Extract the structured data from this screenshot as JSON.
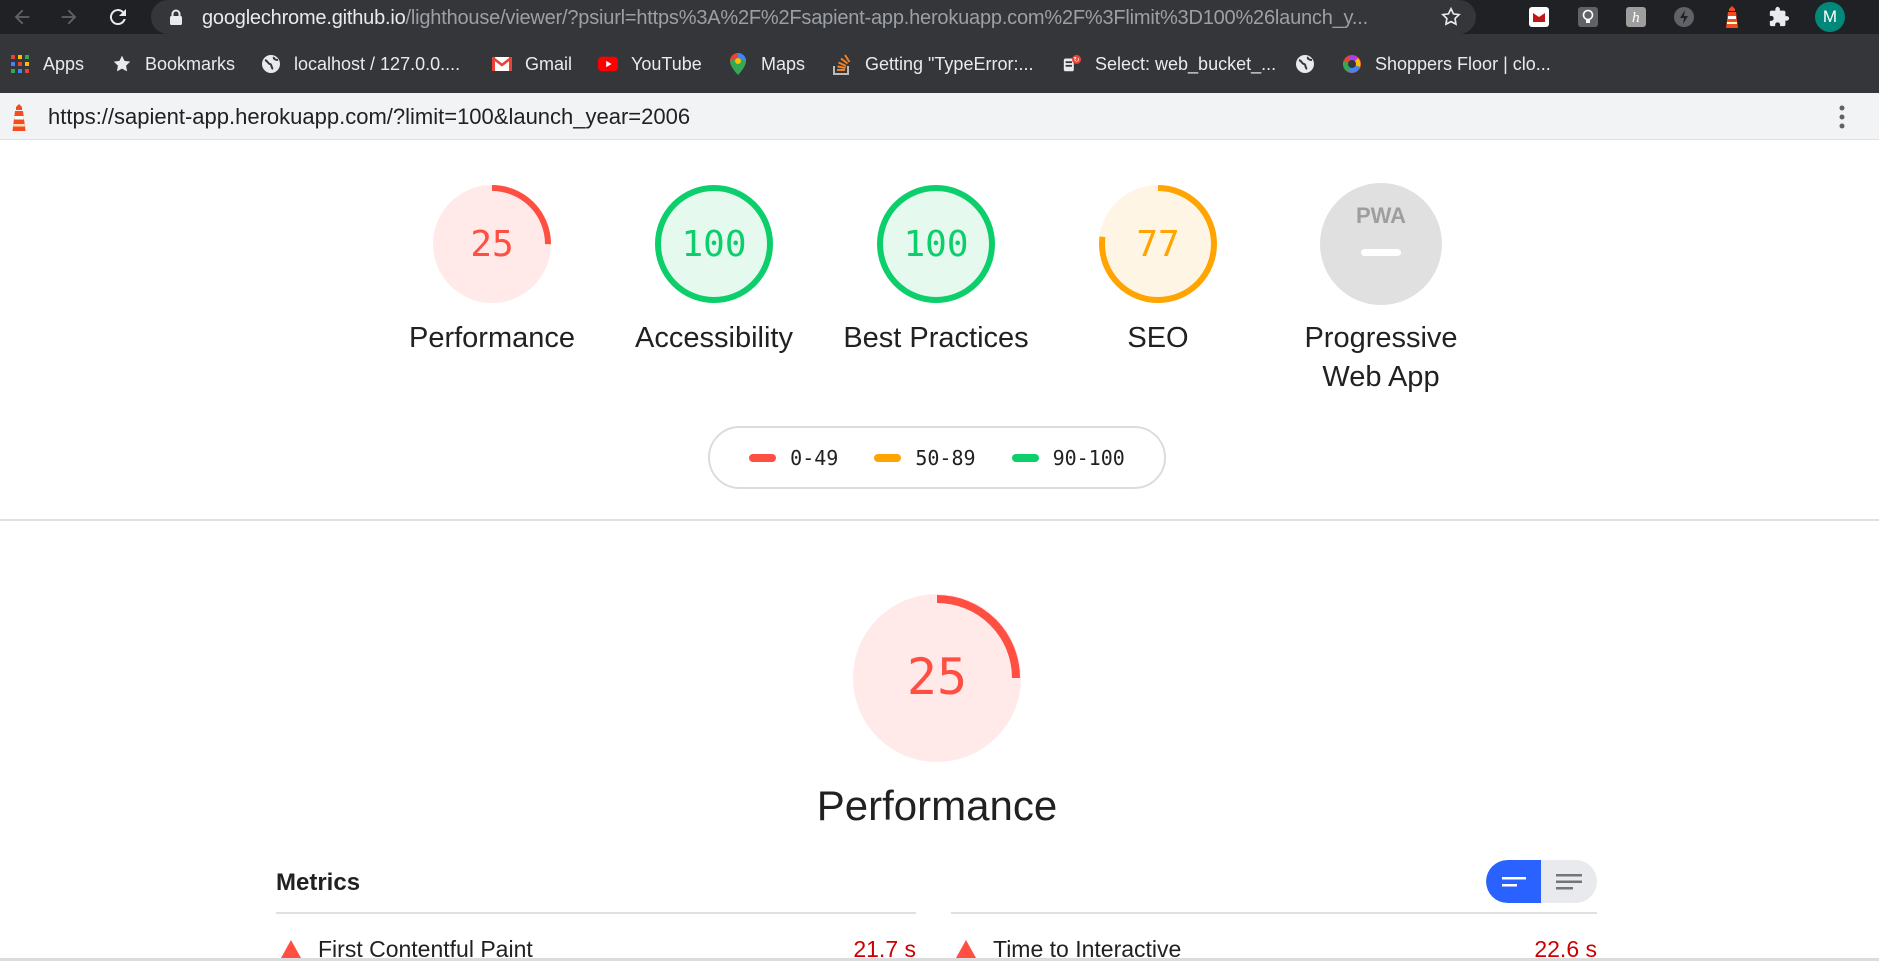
{
  "browser": {
    "url_host": "googlechrome.github.io",
    "url_path": "/lighthouse/viewer/?psiurl=https%3A%2F%2Fsapient-app.herokuapp.com%2F%3Flimit%3D100%26launch_y...",
    "profile_initial": "M",
    "extensions": [
      "mcafee-icon",
      "bulb-icon",
      "heroku-icon",
      "lightning-icon",
      "lighthouse-icon",
      "puzzle-icon"
    ]
  },
  "bookmarks": [
    {
      "label": "Apps",
      "icon": "apps-grid-icon"
    },
    {
      "label": "Bookmarks",
      "icon": "star-icon"
    },
    {
      "label": "localhost / 127.0.0....",
      "icon": "globe-icon"
    },
    {
      "label": "Gmail",
      "icon": "gmail-icon"
    },
    {
      "label": "YouTube",
      "icon": "youtube-icon"
    },
    {
      "label": "Maps",
      "icon": "maps-icon"
    },
    {
      "label": "Getting \"TypeError:...",
      "icon": "stackoverflow-icon"
    },
    {
      "label": "Select: web_bucket_...",
      "icon": "db-icon"
    },
    {
      "label": "",
      "icon": "globe-icon"
    },
    {
      "label": "Shoppers Floor | clo...",
      "icon": "chrome-like-icon"
    }
  ],
  "viewer": {
    "report_url": "https://sapient-app.herokuapp.com/?limit=100&launch_year=2006"
  },
  "categories": [
    {
      "name": "Performance",
      "score": "25",
      "score_fraction": 0.25,
      "rating": "fail"
    },
    {
      "name": "Accessibility",
      "score": "100",
      "score_fraction": 1.0,
      "rating": "pass"
    },
    {
      "name": "Best Practices",
      "score": "100",
      "score_fraction": 1.0,
      "rating": "pass"
    },
    {
      "name": "SEO",
      "score": "77",
      "score_fraction": 0.77,
      "rating": "average"
    },
    {
      "name": "Progressive Web App",
      "score": "",
      "score_fraction": 0,
      "rating": "pwa"
    }
  ],
  "pwa_badge_text": "PWA",
  "legend": [
    {
      "range": "0-49",
      "color": "#ff4e42"
    },
    {
      "range": "50-89",
      "color": "#ffa400"
    },
    {
      "range": "90-100",
      "color": "#0cce6b"
    }
  ],
  "performance_section": {
    "score": "25",
    "score_fraction": 0.25,
    "title": "Performance"
  },
  "metrics": {
    "title": "Metrics",
    "items": [
      {
        "name": "First Contentful Paint",
        "value": "21.7 s"
      },
      {
        "name": "Time to Interactive",
        "value": "22.6 s"
      }
    ]
  },
  "colors": {
    "fail": "#ff4e42",
    "average": "#ffa400",
    "pass": "#0cce6b",
    "toggle_active": "#2962ff"
  }
}
